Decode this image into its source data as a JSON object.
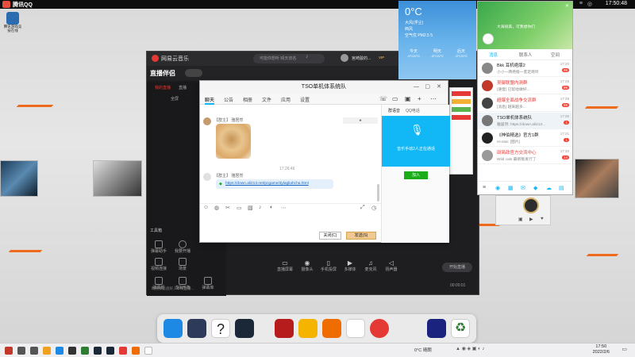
{
  "topbar": {
    "title": "腾讯QQ",
    "clock": "17:50:48"
  },
  "desktop": {
    "icon_label": "腾讯游戏竞技在线"
  },
  "music": {
    "app_name": "网易云音乐",
    "search_placeholder": "可能你想听 晴天旧名",
    "user": "宫崎骏的...",
    "vip": "VIP",
    "live_brand": "直播伴侣",
    "side_label": "我的直播",
    "side_label2": "直播",
    "side_label3": "全屏",
    "tool_label": "工具箱",
    "tools": [
      "弹幕助手",
      "我要开播",
      "视频连接",
      "场景",
      "弹幕姬",
      "虚拟形象",
      "弹幕库"
    ],
    "bottom_tools": [
      "直播屏幕",
      "摄像头",
      "手机投屏",
      "多媒体",
      "麦克风",
      "扬声器"
    ],
    "stat": "00:00:01",
    "start_btn": "开始直播",
    "hint": "网络状态良好，本场直播..."
  },
  "chat": {
    "title": "TSO单机体系统队",
    "tabs": [
      "聊天",
      "公告",
      "相册",
      "文件",
      "应用",
      "设置"
    ],
    "sender1": "【群主】 雅居然",
    "time_center": "17:26:46",
    "sender2": "【群主】 雅居然",
    "link": "https://down.ali213.net/pcgame/dylagliahcha.html",
    "side_tabs": [
      "群语音",
      "QQ电话"
    ],
    "voice_text": "音乐手动2人正在通话",
    "join_btn": "加入",
    "close_btn": "关闭(C)",
    "send_btn": "发送(S)"
  },
  "weather": {
    "temp": "0°C",
    "desc1": "大风(浮尘)",
    "desc2": "西风",
    "desc3": "空气优 PM2.5 5",
    "days": [
      {
        "name": "今天",
        "range": "-9°C/0°C"
      },
      {
        "name": "明天",
        "range": "-8°C/0°C"
      },
      {
        "name": "后天",
        "range": "-9°C/0°C"
      }
    ]
  },
  "qq": {
    "banner": "大海很美，可我想你们",
    "tabs": [
      "消息",
      "联系人",
      "空间"
    ],
    "rows": [
      {
        "name": "Bkk 耳机绝版2",
        "msg": "小小一两绝版一套定呢听",
        "time": "17:20",
        "badge": "99"
      },
      {
        "name": "吴御联盟内测群",
        "msg": "[语音] 已帮他做好...",
        "time": "17:28",
        "badge": "99"
      },
      {
        "name": "超爆全面战争交流群",
        "msg": "[消息] 越来越多...",
        "time": "17:29",
        "badge": "99"
      },
      {
        "name": "TSO单机体系统队",
        "msg": "雅居然: https://down.ali213...",
        "time": "17:26",
        "badge": "1"
      },
      {
        "name": "《神伯精选》官方1群",
        "msg": "Hi-star: [图片]",
        "time": "17:21",
        "badge": "1"
      },
      {
        "name": "田简政官方交流中心",
        "msg": "Wild cats 最新版发行了",
        "time": "17:20",
        "badge": "14"
      }
    ]
  },
  "taskbar": {
    "weather": "0°C 晴朗",
    "time": "17:50",
    "date": "2022/2/6"
  }
}
